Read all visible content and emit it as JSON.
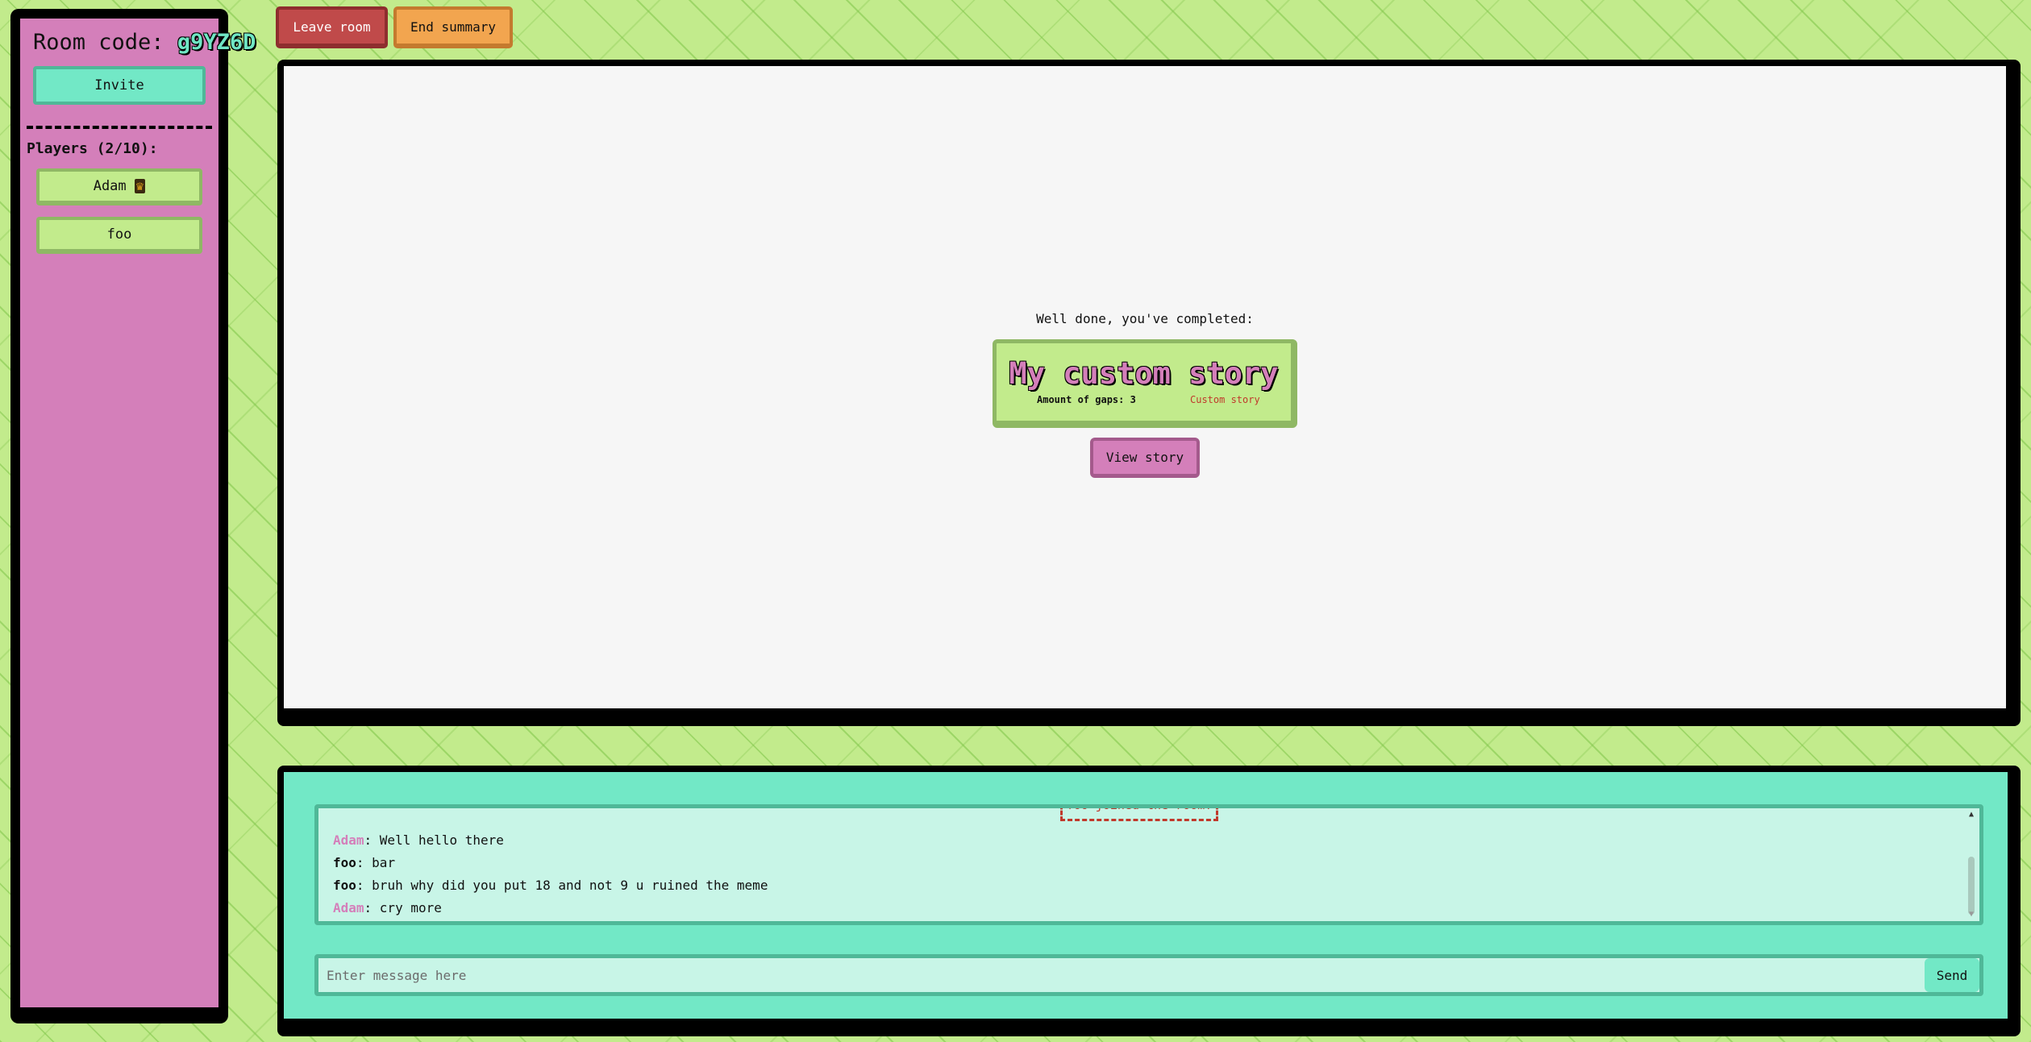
{
  "colors": {
    "background": "#c2eb8c",
    "sidebar": "#d47fba",
    "accent_teal": "#72e8c6",
    "player_card": "#c2eb8c",
    "leave_button": "#c04a4a",
    "end_button": "#f2a54f",
    "notice_red": "#c0392b"
  },
  "sidebar": {
    "room_code_label": "Room code:",
    "room_code": "g9YZ6D",
    "invite_label": "Invite",
    "players_title": "Players (2/10):",
    "players": [
      {
        "name": "Adam",
        "is_host": true,
        "host_icon": "crown-icon"
      },
      {
        "name": "foo",
        "is_host": false
      }
    ]
  },
  "toolbar": {
    "leave_label": "Leave room",
    "end_summary_label": "End summary"
  },
  "main": {
    "completed_text": "Well done, you've completed:",
    "story": {
      "title": "My custom story",
      "gaps_text": "Amount of gaps: 3",
      "type": "Custom story"
    },
    "view_story_label": "View story"
  },
  "chat": {
    "join_notice": "foo joined the room!",
    "messages": [
      {
        "author": "Adam",
        "text": ": Well hello there",
        "author_color": "#d47fba"
      },
      {
        "author": "foo",
        "text": ": bar",
        "author_color": "#111111"
      },
      {
        "author": "foo",
        "text": ": bruh why did you put 18 and not 9 u ruined the meme",
        "author_color": "#111111"
      },
      {
        "author": "Adam",
        "text": ": cry more",
        "author_color": "#d47fba"
      }
    ],
    "input_placeholder": "Enter message here",
    "input_value": "",
    "send_label": "Send"
  }
}
